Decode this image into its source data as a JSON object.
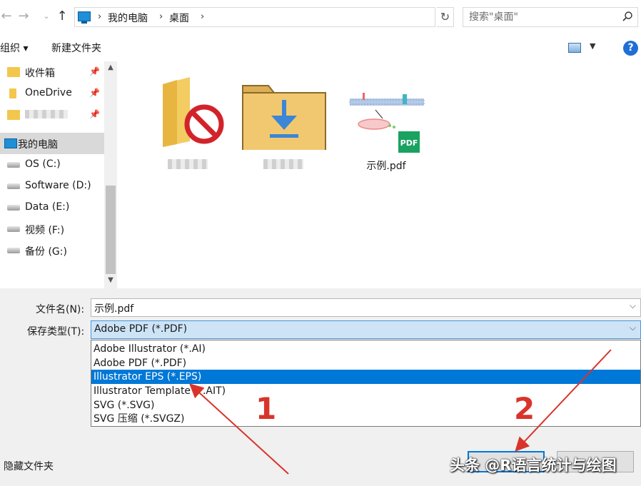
{
  "address": {
    "crumbs": [
      "我的电脑",
      "桌面"
    ],
    "search_placeholder": "搜索\"桌面\""
  },
  "toolbar": {
    "organize": "组织 ▾",
    "new_folder": "新建文件夹",
    "help": "?"
  },
  "sidebar": {
    "items": [
      {
        "label": "收件箱",
        "icon": "inbox-folder-icon"
      },
      {
        "label": "OneDrive",
        "icon": "onedrive-folder-icon"
      },
      {
        "label": "",
        "icon": "blocked-folder-icon"
      },
      {
        "label": "我的电脑",
        "icon": "computer-icon"
      },
      {
        "label": "OS (C:)",
        "icon": "drive-icon"
      },
      {
        "label": "Software (D:)",
        "icon": "drive-icon"
      },
      {
        "label": "Data (E:)",
        "icon": "drive-icon"
      },
      {
        "label": "视频 (F:)",
        "icon": "drive-icon"
      },
      {
        "label": "备份 (G:)",
        "icon": "drive-icon"
      }
    ]
  },
  "files": [
    {
      "name": "",
      "icon": "blocked-folder-icon"
    },
    {
      "name": "",
      "icon": "downloads-folder-icon"
    },
    {
      "name": "示例.pdf",
      "icon": "pdf-file-icon"
    }
  ],
  "form": {
    "filename_label": "文件名(N):",
    "filename_value": "示例.pdf",
    "type_label": "保存类型(T):",
    "type_value": "Adobe PDF (*.PDF)",
    "type_options": [
      "Adobe Illustrator (*.AI)",
      "Adobe PDF (*.PDF)",
      "Illustrator EPS (*.EPS)",
      "Illustrator Template (*.AIT)",
      "SVG (*.SVG)",
      "SVG 压缩 (*.SVGZ)"
    ],
    "highlighted_option": 2,
    "hide_folders": "隐藏文件夹"
  },
  "annotations": {
    "marker1": "1",
    "marker2": "2"
  },
  "watermark": "头条 @R语言统计与绘图",
  "colors": {
    "accent": "#0078d7",
    "annotation": "#d9342b"
  }
}
